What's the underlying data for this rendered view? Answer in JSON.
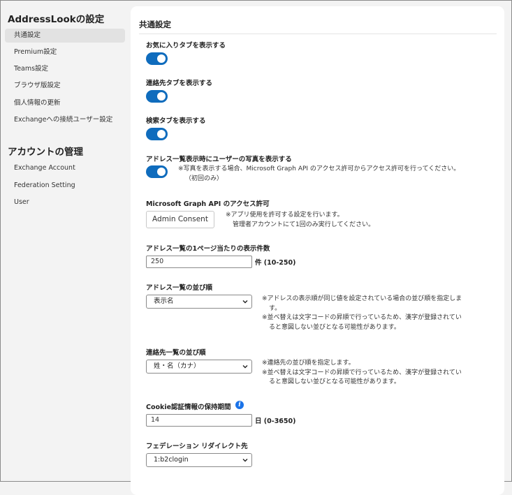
{
  "sidebar": {
    "section1_title": "AddressLookの設定",
    "section1_items": [
      "共通設定",
      "Premium設定",
      "Teams設定",
      "ブラウザ版設定",
      "個人情報の更新",
      "Exchangeへの接続ユーザー設定"
    ],
    "section2_title": "アカウントの管理",
    "section2_items": [
      "Exchange Account",
      "Federation Setting",
      "User"
    ]
  },
  "main": {
    "title": "共通設定",
    "favorites_tab": {
      "label": "お気に入りタブを表示する",
      "enabled": true
    },
    "contacts_tab": {
      "label": "連絡先タブを表示する",
      "enabled": true
    },
    "search_tab": {
      "label": "検索タブを表示する",
      "enabled": true
    },
    "user_photo": {
      "label": "アドレス一覧表示時にユーザーの写真を表示する",
      "enabled": true,
      "note_line1": "※写真を表示する場合、Microsoft Graph API のアクセス許可からアクセス許可を行ってください。",
      "note_line2": "（初回のみ）"
    },
    "graph_api": {
      "label": "Microsoft Graph API のアクセス許可",
      "button": "Admin Consent",
      "note_line1": "※アプリ使用を許可する設定を行います。",
      "note_line2": "管理者アカウントにて1回のみ実行してください。"
    },
    "page_size": {
      "label": "アドレス一覧の1ページ当たりの表示件数",
      "value": "250",
      "suffix": "件 (10-250)"
    },
    "address_sort": {
      "label": "アドレス一覧の並び順",
      "selected": "表示名",
      "note_lines": [
        "※アドレスの表示順が同じ値を設定されている場合の並び順を指定しま",
        "す。",
        "※並べ替えは文字コードの昇順で行っているため、漢字が登録されてい",
        "ると意図しない並びとなる可能性があります。"
      ]
    },
    "contact_sort": {
      "label": "連絡先一覧の並び順",
      "selected": "姓・名（カナ）",
      "note_lines": [
        "※連絡先の並び順を指定します。",
        "※並べ替えは文字コードの昇順で行っているため、漢字が登録されてい",
        "ると意図しない並びとなる可能性があります。"
      ]
    },
    "cookie_retention": {
      "label": "Cookie認証情報の保持期間",
      "info_icon": "info-icon",
      "value": "14",
      "suffix": "日 (0-3650)"
    },
    "federation_redirect": {
      "label": "フェデレーション リダイレクト先",
      "selected": "1:b2clogin"
    }
  },
  "colors": {
    "accent": "#0f6cbd",
    "info": "#1a73e8",
    "active_bg": "#e2e2e2",
    "background": "#f3f3f3"
  }
}
